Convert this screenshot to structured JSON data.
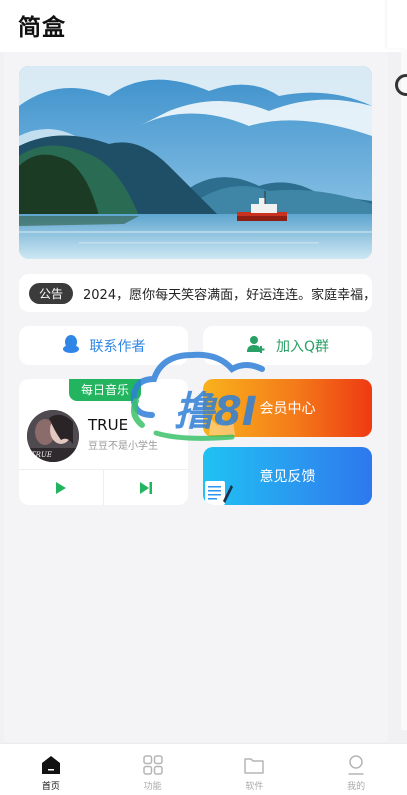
{
  "app": {
    "title": "简盒"
  },
  "notice": {
    "tag": "公告",
    "text": "2024，愿你每天笑容满面，好运连连。家庭幸福，"
  },
  "actions": {
    "contact_label": "联系作者",
    "group_label": "加入Q群"
  },
  "music": {
    "badge": "每日音乐",
    "song_title": "TRUE",
    "artist": "豆豆不是小学生",
    "cover_text": "TRUE"
  },
  "cards": {
    "vip_label": "会员中心",
    "feedback_label": "意见反馈"
  },
  "watermark": {
    "text": "撸8I"
  },
  "tabs": [
    {
      "label": "首页",
      "icon": "home-icon",
      "active": true
    },
    {
      "label": "功能",
      "icon": "grid-icon",
      "active": false
    },
    {
      "label": "软件",
      "icon": "folder-icon",
      "active": false
    },
    {
      "label": "我的",
      "icon": "user-icon",
      "active": false
    }
  ],
  "colors": {
    "accent_blue": "#2f86e6",
    "accent_green": "#22b45e",
    "vip_orange": "#f47a1a",
    "feedback_blue": "#2b95ef"
  }
}
